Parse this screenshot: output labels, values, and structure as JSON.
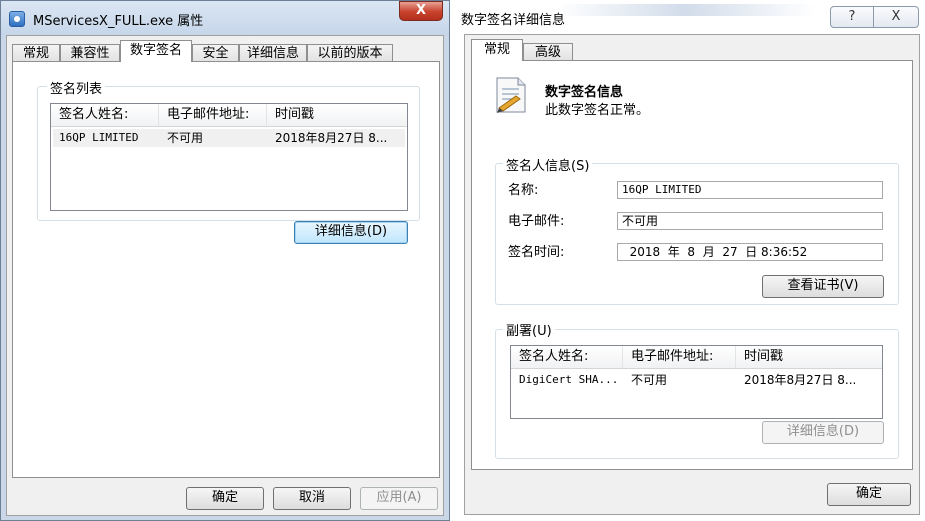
{
  "props_window": {
    "title": "MServicesX_FULL.exe 属性",
    "close_label": "X",
    "tabs": [
      "常规",
      "兼容性",
      "数字签名",
      "安全",
      "详细信息",
      "以前的版本"
    ],
    "active_tab": "数字签名",
    "signature_list": {
      "group_label": "签名列表",
      "columns": [
        "签名人姓名:",
        "电子邮件地址:",
        "时间戳"
      ],
      "rows": [
        {
          "name": "16QP LIMITED",
          "email": "不可用",
          "timestamp": "2018年8月27日 8..."
        }
      ]
    },
    "details_button": "详细信息(D)",
    "ok_button": "确定",
    "cancel_button": "取消",
    "apply_button": "应用(A)"
  },
  "details_window": {
    "title": "数字签名详细信息",
    "help_label": "?",
    "close_label": "X",
    "tabs": [
      "常规",
      "高级"
    ],
    "active_tab": "常规",
    "info_heading": "数字签名信息",
    "info_status": "此数字签名正常。",
    "signer_group_label": "签名人信息(S)",
    "name_label": "名称:",
    "name_value": "16QP LIMITED",
    "email_label": "电子邮件:",
    "email_value": "不可用",
    "signing_time_label": "签名时间:",
    "signing_time_value": "  2018  年  8  月  27  日 8:36:52",
    "view_cert_button": "查看证书(V)",
    "countersign_group_label": "副署(U)",
    "counter_columns": [
      "签名人姓名:",
      "电子邮件地址:",
      "时间戳"
    ],
    "counter_rows": [
      {
        "name": "DigiCert SHA...",
        "email": "不可用",
        "timestamp": "2018年8月27日 8..."
      }
    ],
    "counter_details_button": "详细信息(D)",
    "ok_button": "确定"
  },
  "colors": {
    "title_bar": "#c9d7e8",
    "close_button": "#c7412c",
    "default_button_border": "#3c7fb1",
    "selected_row": "#f0f0f0"
  },
  "icons": [
    "app-icon",
    "close-icon",
    "help-icon",
    "certificate-icon"
  ]
}
